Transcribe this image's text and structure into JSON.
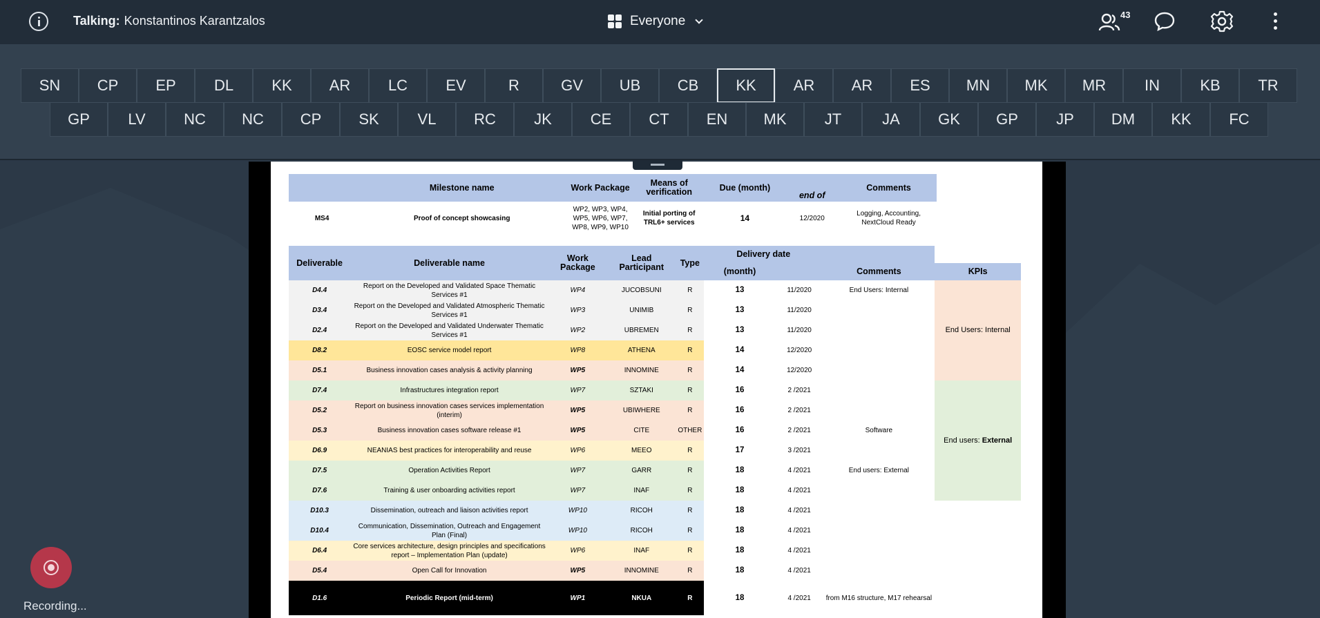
{
  "topbar": {
    "talking_label": "Talking:",
    "talking_name": "Konstantinos Karantzalos",
    "view_label": "Everyone",
    "participants_count": "43",
    "icons": [
      "info-icon",
      "grid-icon",
      "chevron-down-icon",
      "participants-icon",
      "chat-icon",
      "gear-icon",
      "more-vertical-icon"
    ]
  },
  "participants": {
    "row1": [
      "SN",
      "CP",
      "EP",
      "DL",
      "KK",
      "AR",
      "LC",
      "EV",
      "R",
      "GV",
      "UB",
      "CB",
      "KK",
      "AR",
      "AR",
      "ES",
      "MN",
      "MK",
      "MR",
      "IN",
      "KB",
      "TR"
    ],
    "row2": [
      "GP",
      "LV",
      "NC",
      "NC",
      "CP",
      "SK",
      "VL",
      "RC",
      "JK",
      "CE",
      "CT",
      "EN",
      "MK",
      "JT",
      "JA",
      "GK",
      "GP",
      "JP",
      "DM",
      "KK",
      "FC"
    ],
    "active_index_row1": 12
  },
  "milestones": {
    "headers": [
      "",
      "Milestone name",
      "Work Package",
      "Means of verification",
      "Due (month)",
      "end of",
      "Comments"
    ],
    "rows": [
      [
        "MS4",
        "Proof of concept showcasing",
        "WP2, WP3, WP4, WP5, WP6, WP7, WP8, WP9, WP10",
        "Initial porting of TRL6+ services",
        "14",
        "12/2020",
        "Logging, Accounting, NextCloud Ready"
      ]
    ]
  },
  "deliverables": {
    "headers": [
      "Deliverable",
      "Deliverable name",
      "Work Package",
      "Lead Participant",
      "Type",
      "Delivery date",
      "(month)",
      "Comments",
      "KPIs"
    ],
    "rows": [
      {
        "id": "D4.4",
        "name": "Report on the Developed and Validated Space Thematic Services #1",
        "wp": "WP4",
        "lead": "JUCOBSUNI",
        "type": "R",
        "month": "13",
        "date": "11/2020",
        "comment": "End Users: Internal"
      },
      {
        "id": "D3.4",
        "name": "Report on the Developed and Validated Atmospheric Thematic Services #1",
        "wp": "WP3",
        "lead": "UNIMIB",
        "type": "R",
        "month": "13",
        "date": "11/2020",
        "comment": ""
      },
      {
        "id": "D2.4",
        "name": "Report on the Developed and Validated Underwater Thematic Services #1",
        "wp": "WP2",
        "lead": "UBREMEN",
        "type": "R",
        "month": "13",
        "date": "11/2020",
        "comment": ""
      },
      {
        "id": "D8.2",
        "name": "EOSC service model report",
        "wp": "WP8",
        "lead": "ATHENA",
        "type": "R",
        "month": "14",
        "date": "12/2020",
        "comment": ""
      },
      {
        "id": "D5.1",
        "name": "Business innovation cases analysis & activity planning",
        "wp": "WP5",
        "lead": "INNOMINE",
        "type": "R",
        "month": "14",
        "date": "12/2020",
        "comment": ""
      },
      {
        "id": "D7.4",
        "name": "Infrastructures integration report",
        "wp": "WP7",
        "lead": "SZTAKI",
        "type": "R",
        "month": "16",
        "date": "2 /2021",
        "comment": ""
      },
      {
        "id": "D5.2",
        "name": "Report on business innovation cases services implementation (interim)",
        "wp": "WP5",
        "lead": "UBIWHERE",
        "type": "R",
        "month": "16",
        "date": "2 /2021",
        "comment": ""
      },
      {
        "id": "D5.3",
        "name": "Business innovation cases software release #1",
        "wp": "WP5",
        "lead": "CITE",
        "type": "OTHER",
        "month": "16",
        "date": "2 /2021",
        "comment": "Software"
      },
      {
        "id": "D6.9",
        "name": "NEANIAS best practices for interoperability and reuse",
        "wp": "WP6",
        "lead": "MEEO",
        "type": "R",
        "month": "17",
        "date": "3 /2021",
        "comment": ""
      },
      {
        "id": "D7.5",
        "name": "Operation Activities Report",
        "wp": "WP7",
        "lead": "GARR",
        "type": "R",
        "month": "18",
        "date": "4 /2021",
        "comment": "End users: External"
      },
      {
        "id": "D7.6",
        "name": "Training & user onboarding activities report",
        "wp": "WP7",
        "lead": "INAF",
        "type": "R",
        "month": "18",
        "date": "4 /2021",
        "comment": ""
      },
      {
        "id": "D10.3",
        "name": "Dissemination, outreach and liaison activities report",
        "wp": "WP10",
        "lead": "RICOH",
        "type": "R",
        "month": "18",
        "date": "4 /2021",
        "comment": ""
      },
      {
        "id": "D10.4",
        "name": "Communication, Dissemination, Outreach and Engagement Plan (Final)",
        "wp": "WP10",
        "lead": "RICOH",
        "type": "R",
        "month": "18",
        "date": "4 /2021",
        "comment": ""
      },
      {
        "id": "D6.4",
        "name": "Core services architecture, design principles and specifications report  – Implementation Plan (update)",
        "wp": "WP6",
        "lead": "INAF",
        "type": "R",
        "month": "18",
        "date": "4 /2021",
        "comment": ""
      },
      {
        "id": "D5.4",
        "name": "Open Call for Innovation",
        "wp": "WP5",
        "lead": "INNOMINE",
        "type": "R",
        "month": "18",
        "date": "4 /2021",
        "comment": ""
      },
      {
        "id": "D1.6",
        "name": "Periodic Report (mid-term)",
        "wp": "WP1",
        "lead": "NKUA",
        "type": "R",
        "month": "18",
        "date": "4 /2021",
        "comment": "from M16 structure, M17 rehearsal"
      }
    ],
    "kpi_internal": "End Users: Internal",
    "kpi_external_prefix": "End users: ",
    "kpi_external_bold": "External"
  },
  "recording": {
    "label": "Recording..."
  },
  "colors": {
    "topbar_bg": "#222d39",
    "strip_bg": "#33414f",
    "stage_bg": "#2c3947",
    "record_red": "#b5374a",
    "header_blue": "#b4c6e7"
  }
}
